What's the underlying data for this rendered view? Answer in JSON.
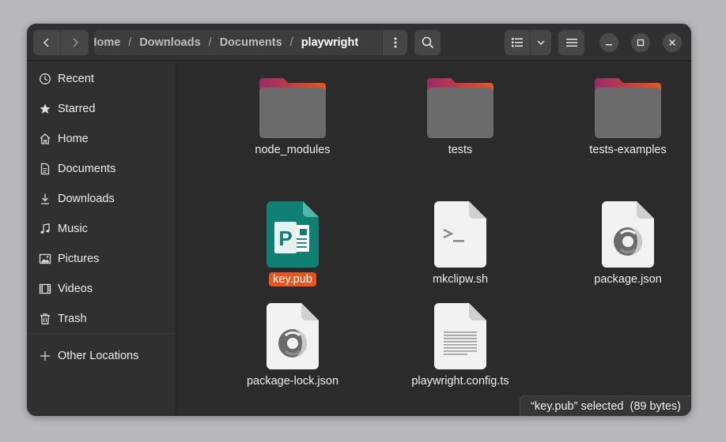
{
  "path": {
    "crumbs": [
      {
        "label": "Home"
      },
      {
        "label": "Downloads"
      },
      {
        "label": "Documents"
      },
      {
        "label": "playwright",
        "current": true
      }
    ],
    "separator": "/"
  },
  "sidebar": {
    "items": [
      {
        "label": "Recent",
        "icon": "clock-icon"
      },
      {
        "label": "Starred",
        "icon": "star-icon"
      },
      {
        "label": "Home",
        "icon": "home-icon"
      },
      {
        "label": "Documents",
        "icon": "document-icon"
      },
      {
        "label": "Downloads",
        "icon": "download-icon"
      },
      {
        "label": "Music",
        "icon": "music-note-icon"
      },
      {
        "label": "Pictures",
        "icon": "picture-icon"
      },
      {
        "label": "Videos",
        "icon": "film-icon"
      },
      {
        "label": "Trash",
        "icon": "trash-icon"
      }
    ],
    "other_locations": "Other Locations"
  },
  "files": [
    {
      "name": "node_modules",
      "type": "folder"
    },
    {
      "name": "tests",
      "type": "folder"
    },
    {
      "name": "tests-examples",
      "type": "folder"
    },
    {
      "name": "key.pub",
      "type": "publisher",
      "selected": true
    },
    {
      "name": "mkclipw.sh",
      "type": "script"
    },
    {
      "name": "package.json",
      "type": "json"
    },
    {
      "name": "package-lock.json",
      "type": "json"
    },
    {
      "name": "playwright.config.ts",
      "type": "text"
    }
  ],
  "status": {
    "text": "“key.pub” selected  (89 bytes)"
  },
  "colors": {
    "accent": "#e95420",
    "folder_tab_start": "#9a2a6a",
    "folder_tab_end": "#e95420",
    "folder_body": "#6b6b6b",
    "publisher_green": "#0f8073"
  }
}
